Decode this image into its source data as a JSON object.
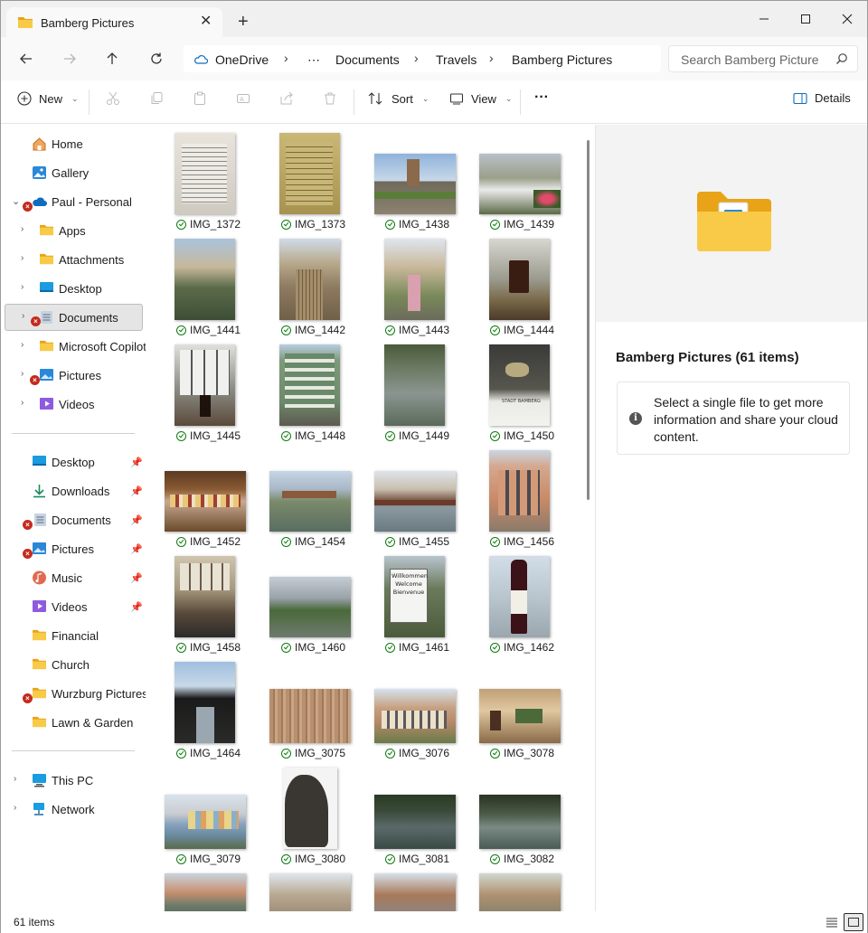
{
  "window": {
    "tab_title": "Bamberg Pictures",
    "tab_close": "✕",
    "new_tab": "+"
  },
  "address": {
    "crumbs": [
      "OneDrive",
      "⋯",
      "Documents",
      "Travels",
      "Bamberg Pictures"
    ],
    "separator": "›",
    "search_placeholder": "Search Bamberg Pictures"
  },
  "toolbar": {
    "new_label": "New",
    "sort_label": "Sort",
    "view_label": "View",
    "more_label": "···",
    "details_label": "Details"
  },
  "nav": {
    "items": [
      {
        "label": "Home",
        "icon": "home-icon"
      },
      {
        "label": "Gallery",
        "icon": "gallery-icon"
      },
      {
        "label": "Paul - Personal",
        "icon": "onedrive-cloud-icon"
      },
      {
        "label": "Apps",
        "icon": "folder-icon"
      },
      {
        "label": "Attachments",
        "icon": "folder-icon"
      },
      {
        "label": "Desktop",
        "icon": "desktop-icon"
      },
      {
        "label": "Documents",
        "icon": "documents-icon"
      },
      {
        "label": "Microsoft Copilot",
        "icon": "folder-icon"
      },
      {
        "label": "Pictures",
        "icon": "pictures-icon"
      },
      {
        "label": "Videos",
        "icon": "videos-icon"
      }
    ],
    "quick": [
      {
        "label": "Desktop",
        "icon": "desktop-icon"
      },
      {
        "label": "Downloads",
        "icon": "downloads-icon"
      },
      {
        "label": "Documents",
        "icon": "documents-icon"
      },
      {
        "label": "Pictures",
        "icon": "pictures-icon"
      },
      {
        "label": "Music",
        "icon": "music-icon"
      },
      {
        "label": "Videos",
        "icon": "videos-icon"
      },
      {
        "label": "Financial",
        "icon": "folder-icon"
      },
      {
        "label": "Church",
        "icon": "folder-icon"
      },
      {
        "label": "Wurzburg Pictures",
        "icon": "folder-icon"
      },
      {
        "label": "Lawn & Garden",
        "icon": "folder-icon"
      }
    ],
    "system": [
      {
        "label": "This PC",
        "icon": "this-pc-icon"
      },
      {
        "label": "Network",
        "icon": "network-icon"
      }
    ]
  },
  "files": [
    "IMG_1372",
    "IMG_1373",
    "IMG_1438",
    "IMG_1439",
    "IMG_1441",
    "IMG_1442",
    "IMG_1443",
    "IMG_1444",
    "IMG_1445",
    "IMG_1448",
    "IMG_1449",
    "IMG_1450",
    "IMG_1452",
    "IMG_1454",
    "IMG_1455",
    "IMG_1456",
    "IMG_1458",
    "IMG_1460",
    "IMG_1461",
    "IMG_1462",
    "IMG_1464",
    "IMG_3075",
    "IMG_3076",
    "IMG_3078",
    "IMG_3079",
    "IMG_3080",
    "IMG_3081",
    "IMG_3082"
  ],
  "thumb_text": {
    "sign": "Willkommen Welcome Bienvenue",
    "plaque": "STADT BAMBERG"
  },
  "details": {
    "title": "Bamberg Pictures (61 items)",
    "message": "Select a single file to get more information and share your cloud content."
  },
  "status": {
    "count": "61 items"
  },
  "colors": {
    "folder_yellow": "#f3c13a",
    "error_red": "#c42b1c",
    "sync_green": "#0f7b0f",
    "onedrive_blue": "#0f6cbd"
  }
}
